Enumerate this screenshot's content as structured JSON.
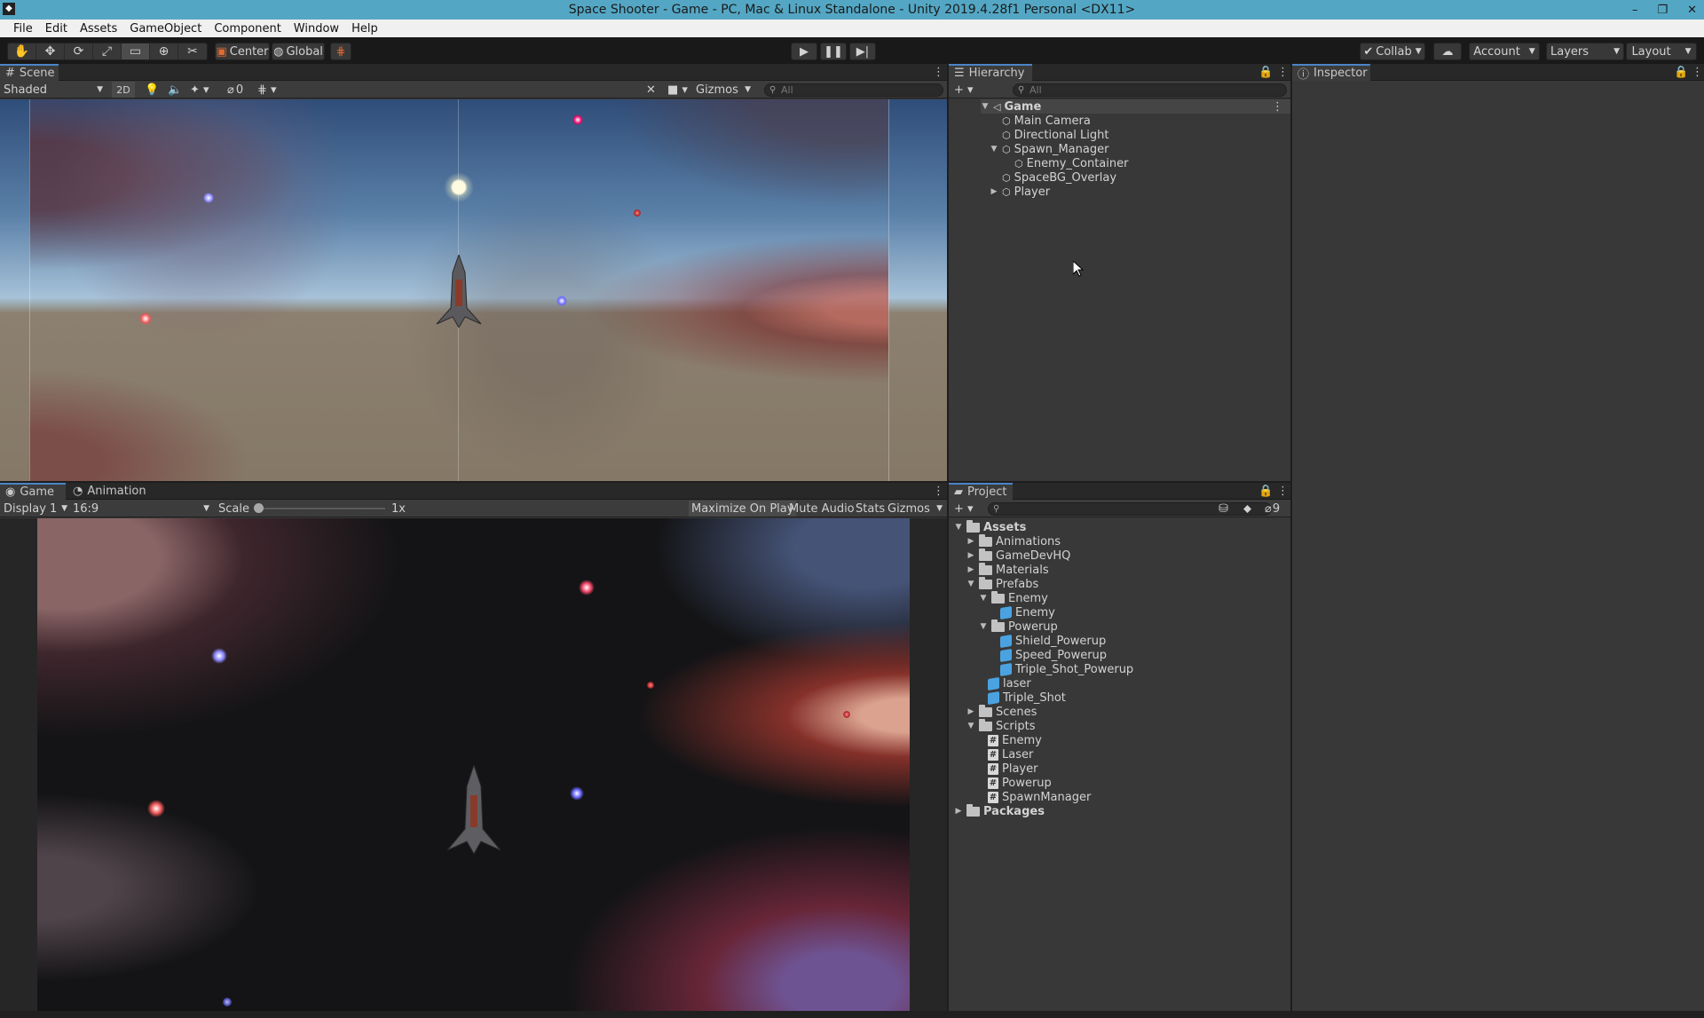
{
  "window": {
    "title": "Space Shooter - Game - PC, Mac & Linux Standalone - Unity 2019.4.28f1 Personal <DX11>",
    "minimize": "–",
    "restore": "❐",
    "close": "✕"
  },
  "menu": [
    "File",
    "Edit",
    "Assets",
    "GameObject",
    "Component",
    "Window",
    "Help"
  ],
  "toolbar": {
    "tools": [
      "hand-tool",
      "move-tool",
      "rotate-tool",
      "scale-tool",
      "rect-tool",
      "transform-tool",
      "custom-tool"
    ],
    "pivot_label": "Center",
    "space_label": "Global",
    "collab_label": "Collab",
    "account_label": "Account",
    "layers_label": "Layers",
    "layout_label": "Layout"
  },
  "scene": {
    "tab_label": "Scene",
    "shading": "Shaded",
    "mode_2d": "2D",
    "hidden_count": "0",
    "gizmos_label": "Gizmos",
    "search_placeholder": "All"
  },
  "game": {
    "tab_label": "Game",
    "animation_tab_label": "Animation",
    "display": "Display 1",
    "aspect": "16:9",
    "scale_label": "Scale",
    "scale_value": "1x",
    "scale_fraction": 0.0,
    "maximize_label": "Maximize On Play",
    "mute_label": "Mute Audio",
    "stats_label": "Stats",
    "gizmos_label": "Gizmos"
  },
  "hierarchy": {
    "tab_label": "Hierarchy",
    "search_placeholder": "All",
    "root": "Game",
    "items": [
      {
        "label": "Main Camera"
      },
      {
        "label": "Directional Light"
      },
      {
        "label": "Spawn_Manager"
      },
      {
        "label": "Enemy_Container"
      },
      {
        "label": "SpaceBG_Overlay"
      },
      {
        "label": "Player"
      }
    ]
  },
  "inspector": {
    "tab_label": "Inspector"
  },
  "project": {
    "tab_label": "Project",
    "hidden_count": "9",
    "items": [
      {
        "label": "Assets"
      },
      {
        "label": "Animations"
      },
      {
        "label": "GameDevHQ"
      },
      {
        "label": "Materials"
      },
      {
        "label": "Prefabs"
      },
      {
        "label": "Enemy"
      },
      {
        "label": "Enemy"
      },
      {
        "label": "Powerup"
      },
      {
        "label": "Shield_Powerup"
      },
      {
        "label": "Speed_Powerup"
      },
      {
        "label": "Triple_Shot_Powerup"
      },
      {
        "label": "laser"
      },
      {
        "label": "Triple_Shot"
      },
      {
        "label": "Scenes"
      },
      {
        "label": "Scripts"
      },
      {
        "label": "Enemy"
      },
      {
        "label": "Laser"
      },
      {
        "label": "Player"
      },
      {
        "label": "Powerup"
      },
      {
        "label": "SpawnManager"
      },
      {
        "label": "Packages"
      }
    ]
  },
  "colors": {
    "titlebar": "#54a7c4",
    "tab_accent": "#4a85c7",
    "panel": "#383838",
    "prefab": "#4aa3e0"
  }
}
